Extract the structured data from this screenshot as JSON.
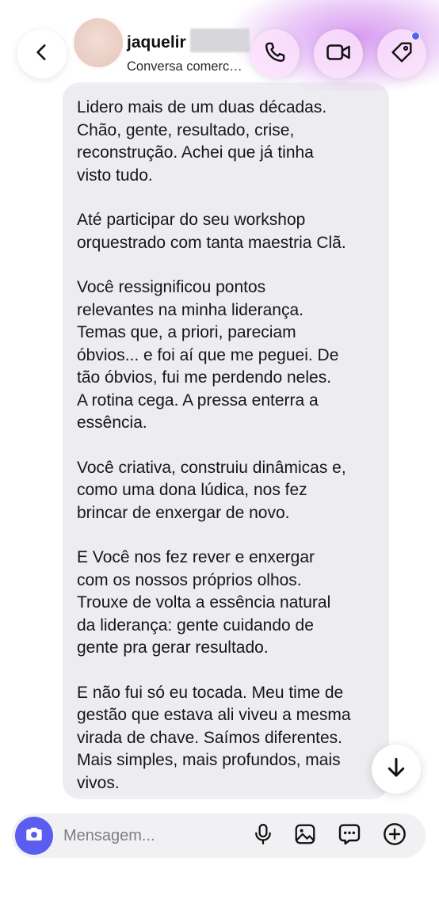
{
  "header": {
    "contact_name": "jaquelir",
    "subtitle": "Conversa comerc…",
    "icons": [
      "back-chevron-icon",
      "phone-icon",
      "video-camera-icon",
      "tag-icon"
    ]
  },
  "message": {
    "paragraphs": [
      [
        "Lidero mais de um duas décadas.",
        "Chão, gente, resultado, crise,",
        "reconstrução. Achei que já tinha",
        "visto tudo."
      ],
      [
        "Até participar do seu workshop",
        "orquestrado com tanta maestria Clã."
      ],
      [
        "Você ressignificou pontos",
        "relevantes na minha liderança.",
        "Temas que, a priori, pareciam",
        "óbvios... e foi aí que me peguei. De",
        "tão óbvios, fui me perdendo neles.",
        "A rotina cega. A pressa enterra a",
        "essência."
      ],
      [
        "Você criativa, construiu dinâmicas e,",
        "como uma dona lúdica, nos fez",
        "brincar de enxergar de novo."
      ],
      [
        "E Você nos fez rever e enxergar",
        "com os nossos próprios olhos.",
        "Trouxe de volta a essência natural",
        "da liderança: gente cuidando de",
        "gente pra gerar resultado."
      ],
      [
        "E não fui só eu tocada. Meu time de",
        "gestão que estava ali viveu a mesma",
        "virada de chave. Saímos diferentes.",
        "Mais simples, mais profundos, mais",
        "vivos."
      ]
    ]
  },
  "composer": {
    "placeholder": "Mensagem...",
    "value": "",
    "icons": [
      "camera-icon",
      "microphone-icon",
      "gallery-icon",
      "sticker-icon",
      "plus-icon"
    ]
  },
  "colors": {
    "bubble": "#ececf1",
    "accent": "#5b5cf0",
    "notification_dot": "#4f63f5",
    "header_glow": "#d696f0"
  }
}
